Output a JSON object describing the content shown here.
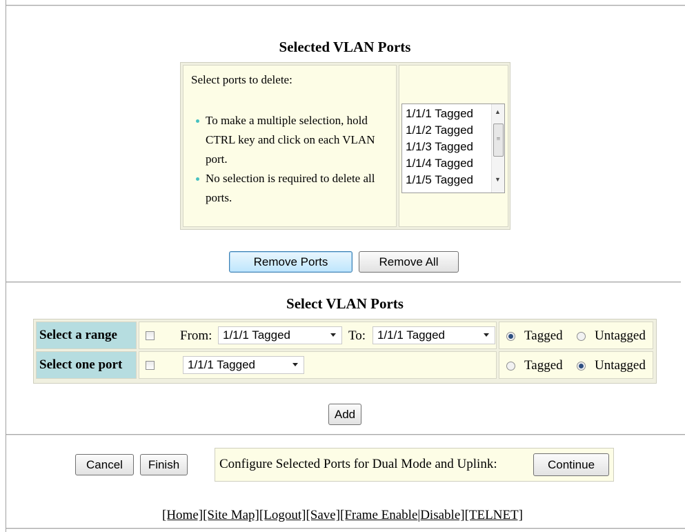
{
  "selected_section": {
    "title": "Selected VLAN Ports",
    "instruction": "Select ports to delete:",
    "bullets": [
      "To make a multiple selection, hold CTRL key and click on each VLAN port.",
      "No selection is required to delete all ports."
    ],
    "ports_list": [
      "1/1/1 Tagged",
      "1/1/2 Tagged",
      "1/1/3 Tagged",
      "1/1/4 Tagged",
      "1/1/5 Tagged"
    ],
    "remove_ports_label": "Remove Ports",
    "remove_all_label": "Remove All"
  },
  "select_section": {
    "title": "Select VLAN Ports",
    "range_row": {
      "label": "Select a range",
      "checked": false,
      "from_label": "From:",
      "from_value": "1/1/1 Tagged",
      "to_label": "To:",
      "to_value": "1/1/1 Tagged",
      "tagged_label": "Tagged",
      "untagged_label": "Untagged",
      "mode": "Tagged"
    },
    "one_row": {
      "label": "Select one port",
      "checked": false,
      "value": "1/1/1 Tagged",
      "tagged_label": "Tagged",
      "untagged_label": "Untagged",
      "mode": "Untagged"
    },
    "add_label": "Add"
  },
  "actions": {
    "cancel_label": "Cancel",
    "finish_label": "Finish",
    "dual_mode_text": "Configure Selected Ports for Dual Mode and Uplink:",
    "continue_label": "Continue"
  },
  "footer_links": [
    "[Home]",
    "[Site Map]",
    "[Logout]",
    "[Save]",
    "[Frame Enable",
    "|Disable]",
    "[TELNET]"
  ]
}
